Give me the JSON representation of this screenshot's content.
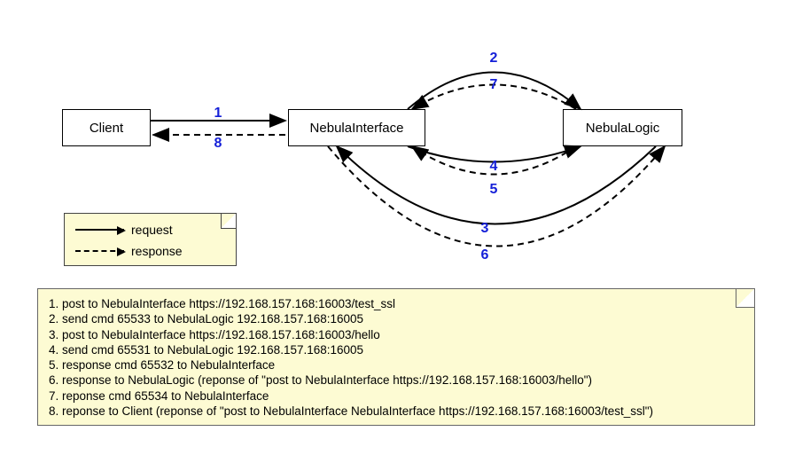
{
  "nodes": {
    "client": "Client",
    "interface": "NebulaInterface",
    "logic": "NebulaLogic"
  },
  "legend": {
    "request": "request",
    "response": "response"
  },
  "edge_numbers": {
    "n1": "1",
    "n2": "2",
    "n3": "3",
    "n4": "4",
    "n5": "5",
    "n6": "6",
    "n7": "7",
    "n8": "8"
  },
  "steps": [
    "1. post to NebulaInterface https://192.168.157.168:16003/test_ssl",
    "2. send cmd 65533 to  NebulaLogic 192.168.157.168:16005",
    "3. post to NebulaInterface https://192.168.157.168:16003/hello",
    "4. send cmd 65531 to  NebulaLogic 192.168.157.168:16005",
    "5. response cmd 65532 to NebulaInterface",
    "6. response to NebulaLogic (reponse of \"post to NebulaInterface https://192.168.157.168:16003/hello\")",
    "7. reponse cmd 65534 to NebulaInterface",
    "8. reponse to Client (reponse of \"post to NebulaInterface NebulaInterface https://192.168.157.168:16003/test_ssl\")"
  ]
}
